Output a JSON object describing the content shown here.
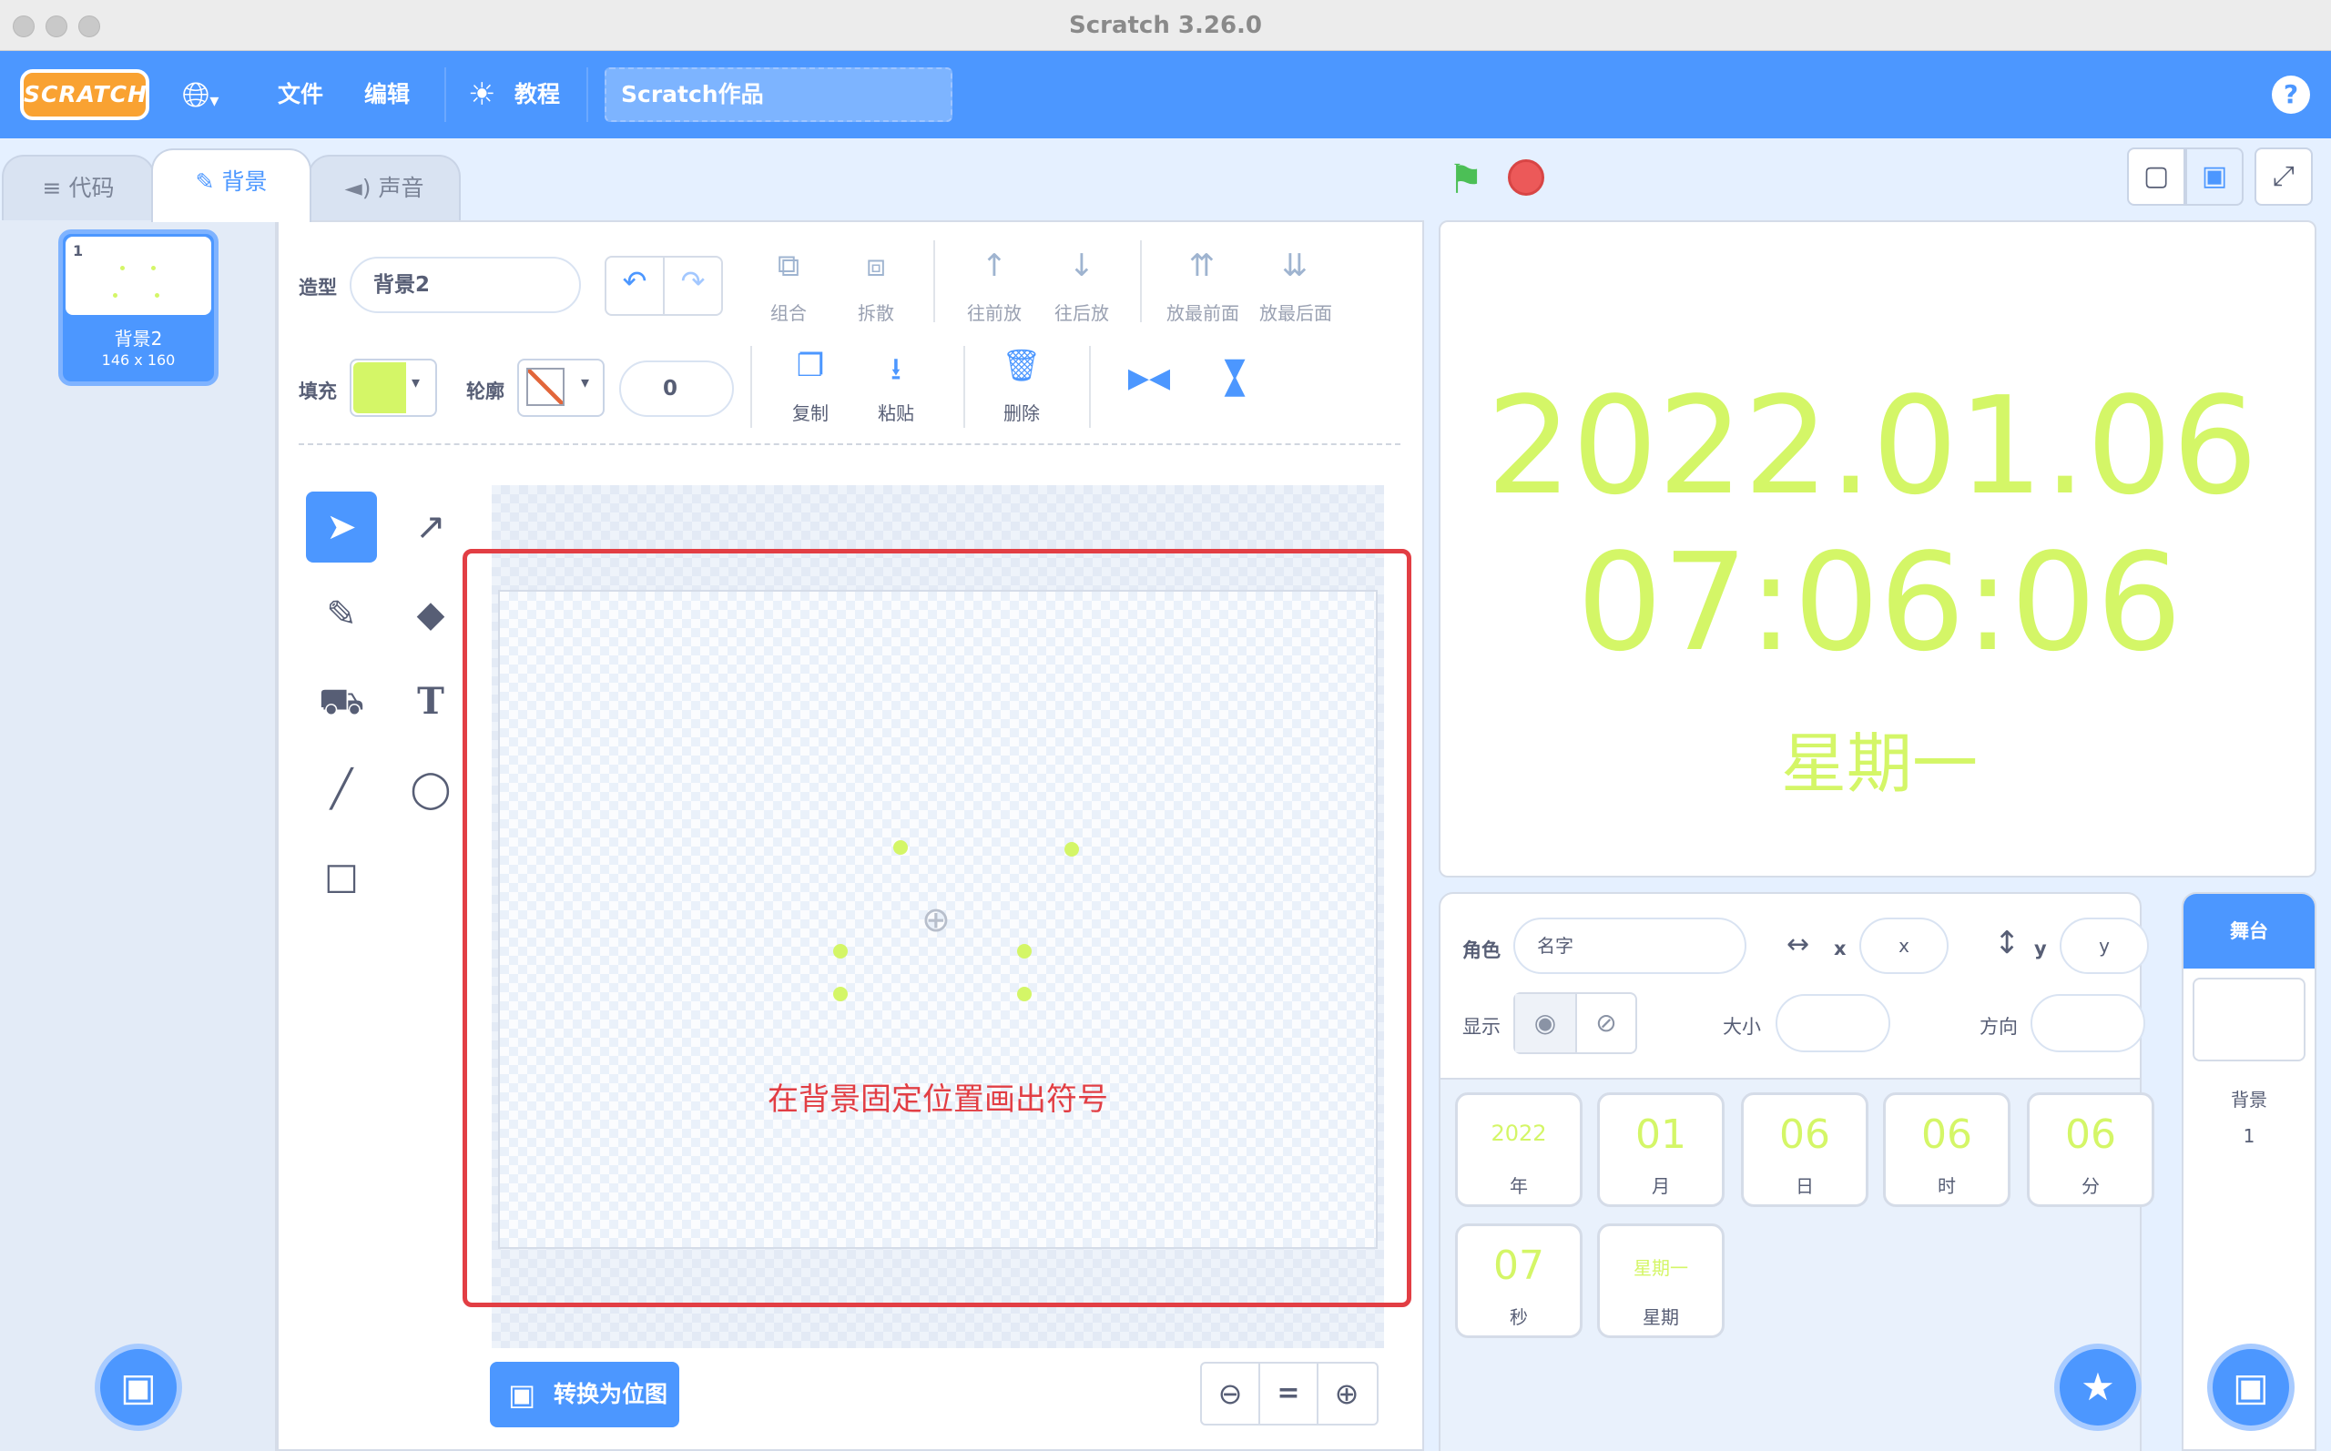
{
  "window": {
    "title": "Scratch 3.26.0"
  },
  "menubar": {
    "logo": "SCRATCH",
    "file": "文件",
    "edit": "编辑",
    "tutorials": "教程",
    "project_title": "Scratch作品",
    "help": "?"
  },
  "tabs": {
    "code": "代码",
    "backdrops": "背景",
    "sounds": "声音"
  },
  "costume_list": {
    "items": [
      {
        "index": "1",
        "name": "背景2",
        "size": "146 x 160"
      }
    ]
  },
  "paint": {
    "costume_label": "造型",
    "costume_name": "背景2",
    "fill_label": "填充",
    "outline_label": "轮廓",
    "outline_width": "0",
    "fill_color": "#d4f667",
    "group": "组合",
    "ungroup": "拆散",
    "forward": "往前放",
    "backward": "往后放",
    "front": "放最前面",
    "back": "放最后面",
    "copy": "复制",
    "paste": "粘贴",
    "delete": "删除",
    "convert_bitmap": "转换为位图",
    "zoom_reset": "="
  },
  "annotation": "在背景固定位置画出符号",
  "stage": {
    "date": "2022.01.06",
    "time": "07:06:06",
    "weekday": "星期一"
  },
  "sprite_info": {
    "sprite_label": "角色",
    "name_placeholder": "名字",
    "x_label": "x",
    "y_label": "y",
    "x_placeholder": "x",
    "y_placeholder": "y",
    "show_label": "显示",
    "size_label": "大小",
    "direction_label": "方向"
  },
  "sprites": [
    {
      "value": "2022",
      "name": "年"
    },
    {
      "value": "01",
      "name": "月"
    },
    {
      "value": "06",
      "name": "日"
    },
    {
      "value": "06",
      "name": "时"
    },
    {
      "value": "06",
      "name": "分"
    },
    {
      "value": "07",
      "name": "秒"
    },
    {
      "value": "星期一",
      "name": "星期"
    }
  ],
  "stage_selector": {
    "header": "舞台",
    "backdrops_label": "背景",
    "backdrops_count": "1"
  }
}
